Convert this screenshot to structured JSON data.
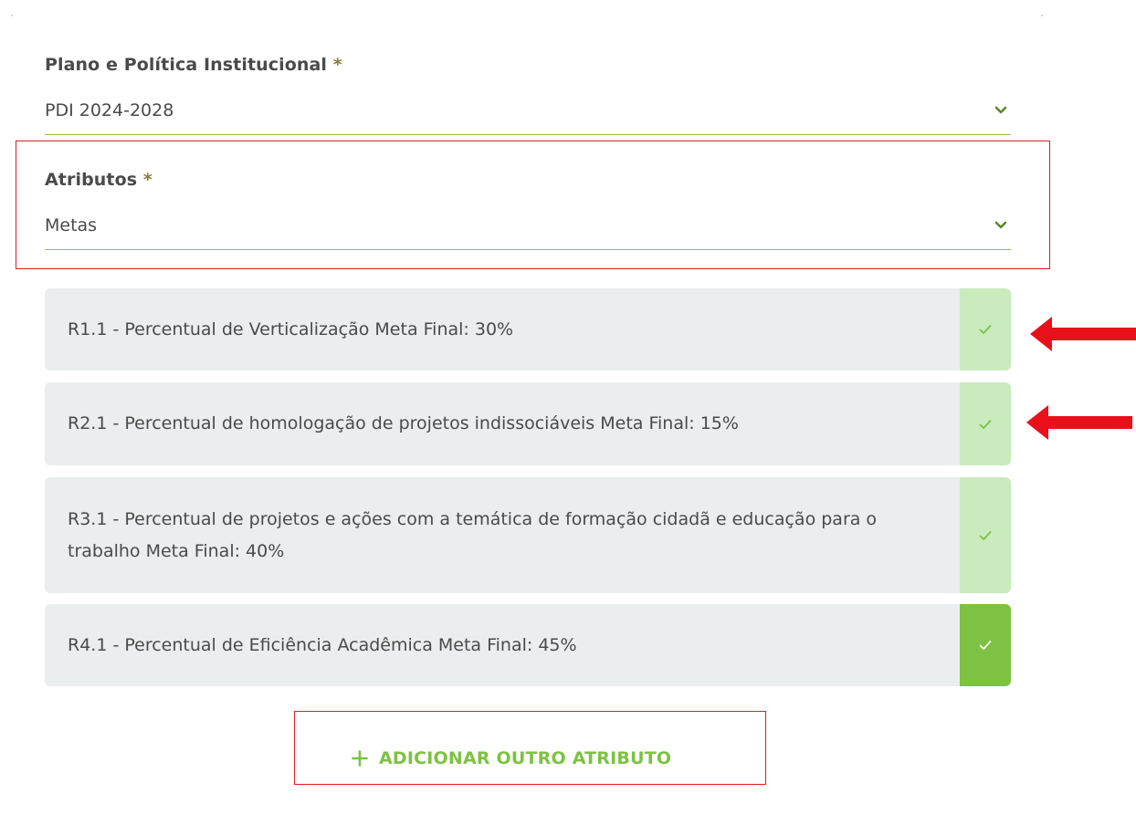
{
  "form": {
    "plano": {
      "label": "Plano e Política Institucional",
      "required_mark": "*",
      "value": "PDI 2024-2028"
    },
    "atributos": {
      "label": "Atributos",
      "required_mark": "*",
      "value": "Metas"
    }
  },
  "metas": [
    {
      "text": "R1.1 - Percentual de Verticalização Meta Final: 30%",
      "selected": true,
      "active": false
    },
    {
      "text": "R2.1 - Percentual de homologação de projetos indissociáveis Meta Final: 15%",
      "selected": true,
      "active": false
    },
    {
      "text": "R3.1 - Percentual de projetos e ações com a temática de formação cidadã e educação para o trabalho Meta Final: 40%",
      "selected": true,
      "active": false
    },
    {
      "text": "R4.1 - Percentual de Eficiência Acadêmica Meta Final: 45%",
      "selected": true,
      "active": true
    }
  ],
  "add_button": {
    "label": "ADICIONAR OUTRO ATRIBUTO",
    "icon": "plus-icon"
  },
  "colors": {
    "accent_green": "#7dc242",
    "light_green": "#c9ebbd",
    "highlight_red": "#e01b24",
    "item_bg": "#ebeeee"
  }
}
